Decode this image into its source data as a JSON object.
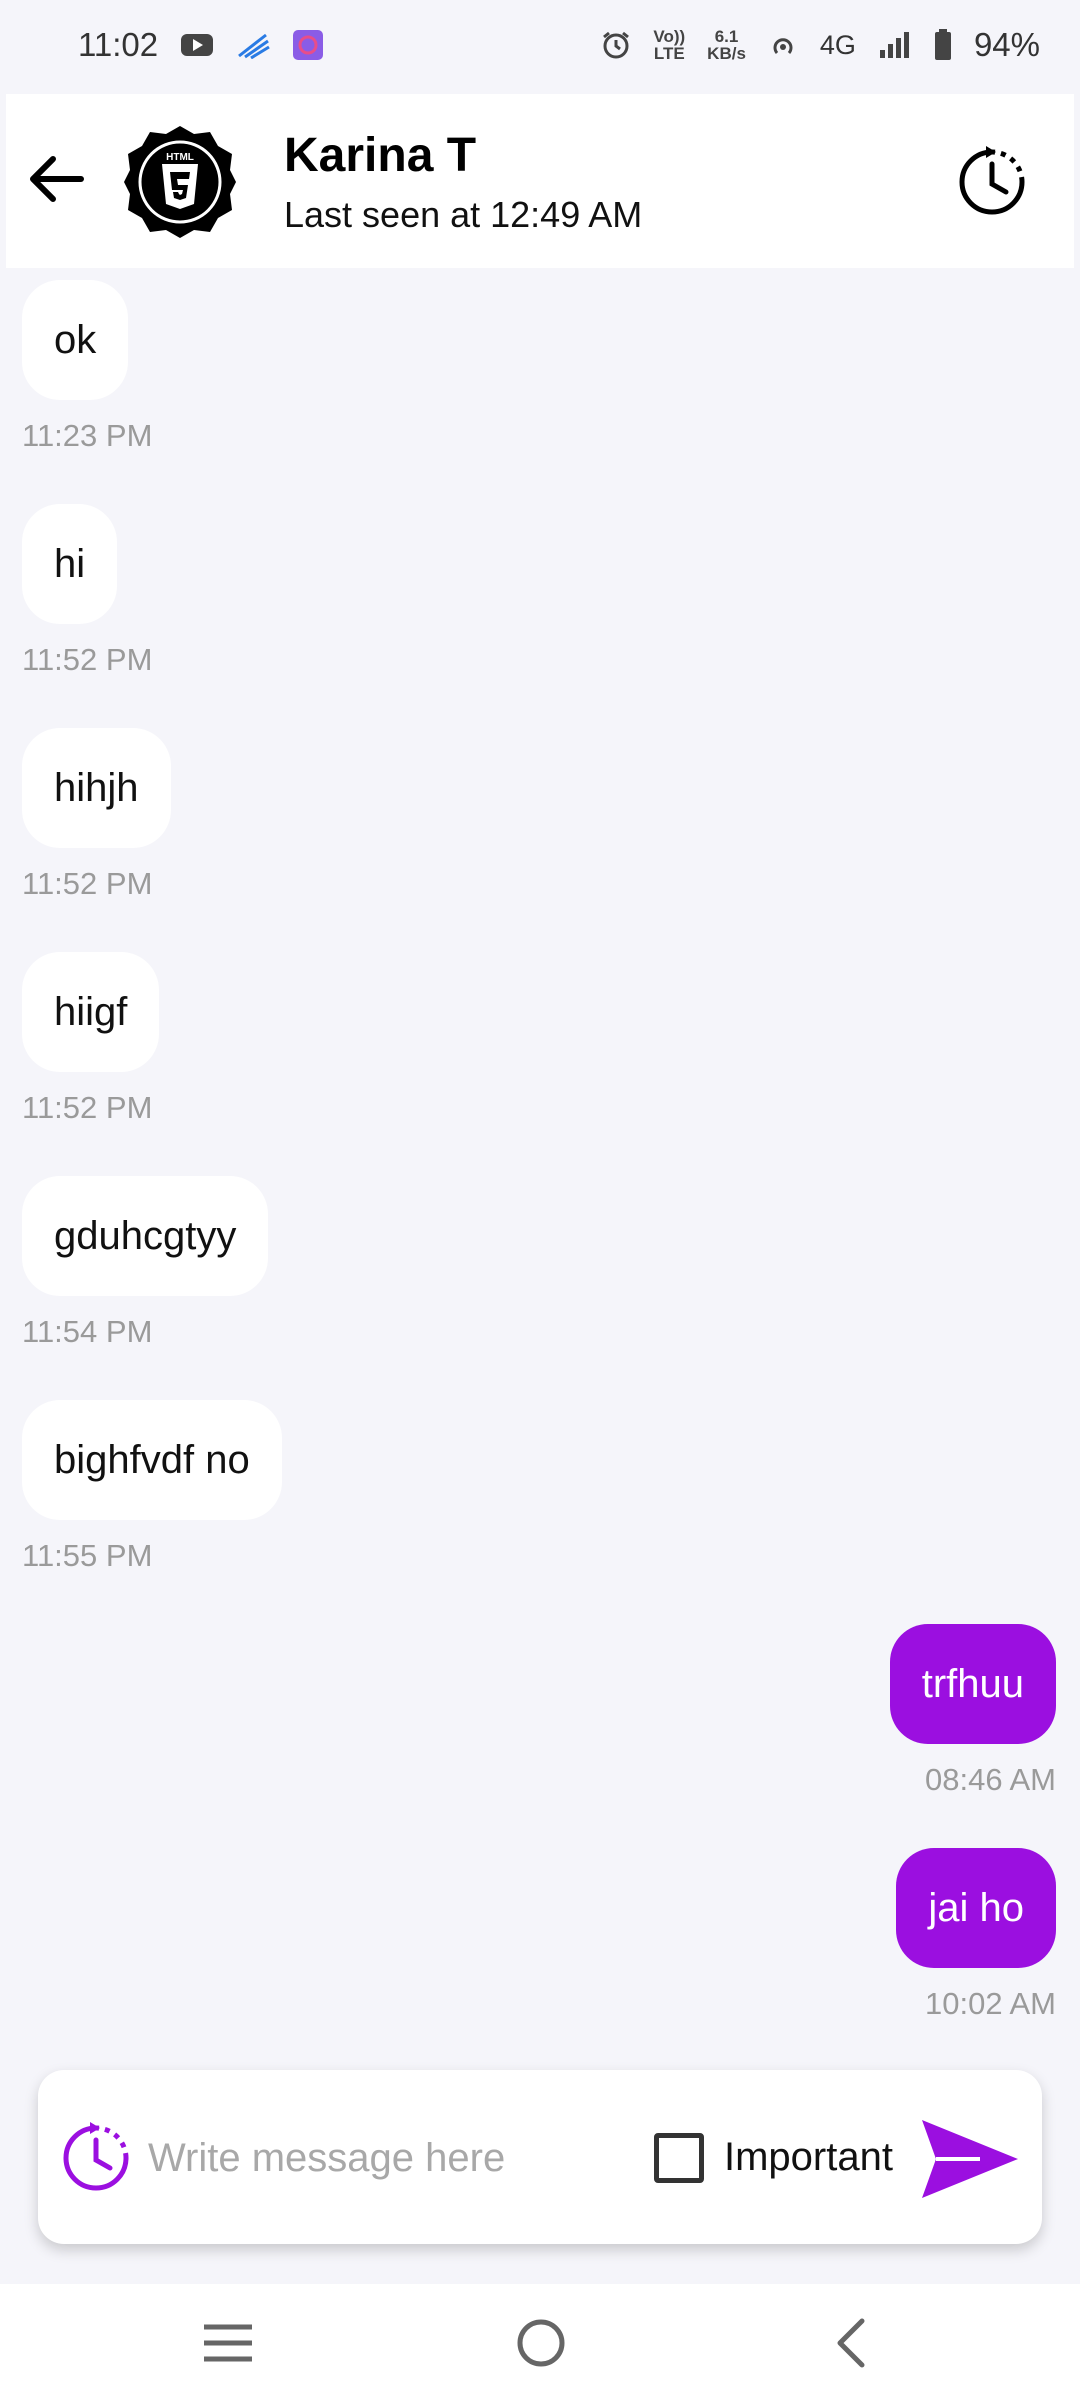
{
  "status_bar": {
    "time": "11:02",
    "network_speed_value": "6.1",
    "network_speed_unit": "KB/s",
    "volte_top": "Vo))",
    "volte_bottom": "LTE",
    "network_type": "4G",
    "battery": "94%"
  },
  "header": {
    "contact_name": "Karina T",
    "last_seen": "Last seen at 12:49 AM",
    "avatar_text": "HTML"
  },
  "messages": [
    {
      "direction": "incoming",
      "text": "ok",
      "time": "11:23 PM"
    },
    {
      "direction": "incoming",
      "text": "hi",
      "time": "11:52 PM"
    },
    {
      "direction": "incoming",
      "text": "hihjh",
      "time": "11:52 PM"
    },
    {
      "direction": "incoming",
      "text": "hiigf",
      "time": "11:52 PM"
    },
    {
      "direction": "incoming",
      "text": "gduhcgtyy",
      "time": "11:54 PM"
    },
    {
      "direction": "incoming",
      "text": "bighfvdf no",
      "time": "11:55 PM"
    },
    {
      "direction": "outgoing",
      "text": "trfhuu",
      "time": "08:46 AM"
    },
    {
      "direction": "outgoing",
      "text": "jai ho",
      "time": "10:02 AM"
    }
  ],
  "composer": {
    "placeholder": "Write message here",
    "value": "",
    "important_label": "Important",
    "important_checked": false
  },
  "colors": {
    "accent": "#9b0fe0",
    "background": "#f5f5fa",
    "incoming_bubble": "#ffffff",
    "timestamp": "#9a9a9a"
  },
  "icons": {
    "back": "arrow-left-icon",
    "schedule": "clock-schedule-icon",
    "send": "send-icon",
    "nav_recents": "menu-icon",
    "nav_home": "home-circle-icon",
    "nav_back": "chevron-left-icon"
  }
}
